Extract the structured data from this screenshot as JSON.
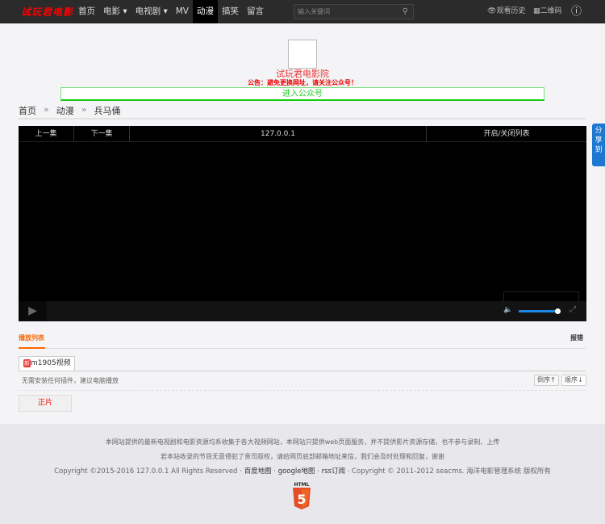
{
  "nav": {
    "logo": "试玩君电影",
    "items": [
      "首页",
      "电影 ▾",
      "电视剧 ▾",
      "MV",
      "动漫",
      "搞笑",
      "留言"
    ],
    "active_index": 4,
    "search_placeholder": "输入关键词",
    "history": "观看历史",
    "qrcode": "二维码"
  },
  "header": {
    "site_name": "试玩君电影院",
    "notice": "公告：避免更换网址，请关注公众号！",
    "gzh_button": "进入公众号"
  },
  "breadcrumb": [
    "首页",
    "动漫",
    "兵马俑"
  ],
  "breadcrumb_sep": "»",
  "player": {
    "prev": "上一集",
    "next": "下一集",
    "host": "127.0.0.1",
    "toggle_list": "开启/关闭列表",
    "volume_percent": 95
  },
  "share": "分享到",
  "playlist": {
    "heading": "播放列表",
    "report": "报错",
    "source_badge": "新",
    "source": "m1905视频",
    "tip": "无需安装任何插件，建议电脑播放",
    "desc": "倒序↑",
    "asc": "顺序↓",
    "episodes": [
      "正片"
    ]
  },
  "footer": {
    "line1": "本网站提供的最新电视剧和电影资源均系收集于各大视频网站，本网站只提供web页面服务，并不提供影片资源存储，也不参与录制、上传",
    "line2": "若本站收录的节目无意侵犯了贵司版权，请给网页底部邮箱地址来信，我们会及时处理和回复，谢谢",
    "copyright": "Copyright ©2015-2016 127.0.0.1 All Rights Reserved · ",
    "baidu": "百度地图",
    "google": "google地图",
    "rss": "rss订阅",
    "copyright2": " · Copyright © 2011-2012 seacms. 海洋电影管理系统 版权所有",
    "html5": "HTML"
  }
}
